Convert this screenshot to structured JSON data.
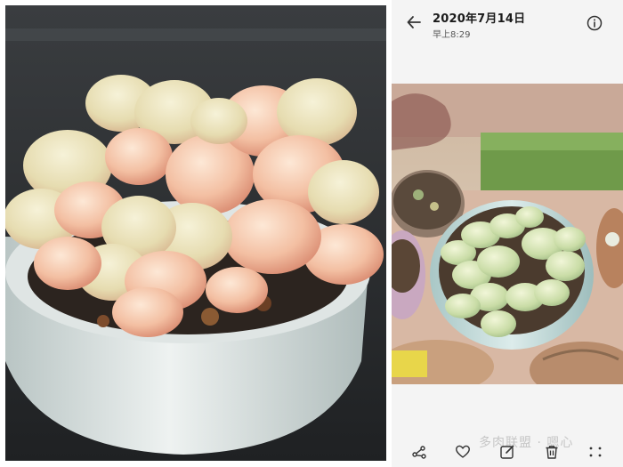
{
  "viewer": {
    "date_title": "2020年7月14日",
    "time_subtitle": "早上8:29",
    "back_icon": "arrow-left-icon",
    "info_icon": "info-icon"
  },
  "left_photo": {
    "subject": "succulent-in-white-pot-photo"
  },
  "main_photo": {
    "subject": "succulent-pots-on-ledge-photo"
  },
  "toolbar": {
    "items": [
      {
        "icon": "share-icon"
      },
      {
        "icon": "heart-icon"
      },
      {
        "icon": "edit-icon"
      },
      {
        "icon": "delete-icon"
      },
      {
        "icon": "more-icon"
      }
    ]
  },
  "watermark": {
    "text": "多肉联盟 · 嗯心"
  },
  "colors": {
    "background": "#ffffff",
    "phone_bg": "#f4f4f4",
    "text_primary": "#1a1a1a",
    "text_secondary": "#555555",
    "icon": "#333333"
  }
}
